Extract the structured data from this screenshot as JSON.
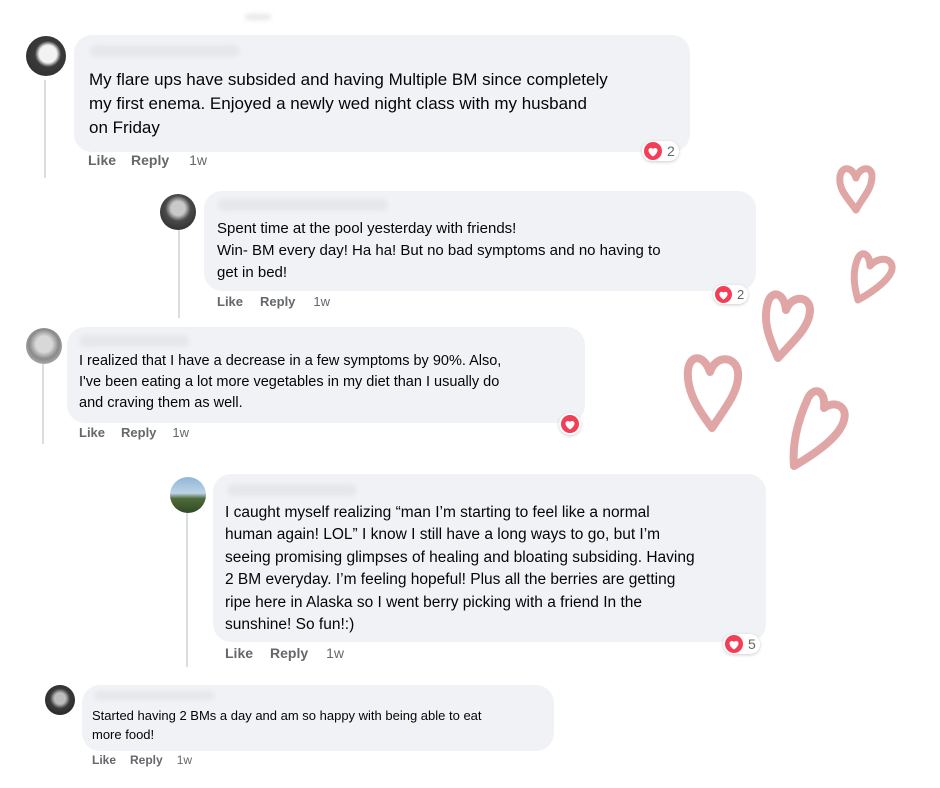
{
  "comments": [
    {
      "text": "My flare ups have subsided and having Multiple BM since completely\nmy first enema. Enjoyed a newly wed night class with my husband\non Friday",
      "actions": {
        "like": "Like",
        "reply": "Reply",
        "time": "1w"
      },
      "reaction_count": "2"
    },
    {
      "text": "Spent time at the pool yesterday with friends!\nWin- BM every day! Ha ha! But no bad symptoms and no having to\nget in bed!",
      "actions": {
        "like": "Like",
        "reply": "Reply",
        "time": "1w"
      },
      "reaction_count": "2"
    },
    {
      "text": "I realized that I have a decrease in a few symptoms by 90%. Also,\nI've been eating a lot more vegetables in my diet than I usually do\nand craving them as well.",
      "actions": {
        "like": "Like",
        "reply": "Reply",
        "time": "1w"
      },
      "reaction_count": ""
    },
    {
      "text": "I caught myself realizing “man I’m starting to feel like a normal\nhuman again! LOL” I know I still have a long ways to go, but I’m\nseeing promising glimpses of healing and bloating subsiding. Having\n2 BM everyday. I’m feeling hopeful! Plus all the berries are getting\nripe here in Alaska so I went berry picking with a friend In the\nsunshine! So fun!:)",
      "actions": {
        "like": "Like",
        "reply": "Reply",
        "time": "1w"
      },
      "reaction_count": "5"
    },
    {
      "text": "Started having 2 BMs a day and am so happy with being able to eat\nmore food!",
      "actions": {
        "like": "Like",
        "reply": "Reply",
        "time": "1w"
      },
      "reaction_count": ""
    }
  ],
  "colors": {
    "bubble": "#f0f2f5",
    "love_reaction": "#f33e58",
    "doodle_hearts": "#e0a6a6",
    "meta_text": "#65676b"
  },
  "icons": {
    "reaction": "heart-icon",
    "decoration": "hand-drawn-heart-icon"
  }
}
